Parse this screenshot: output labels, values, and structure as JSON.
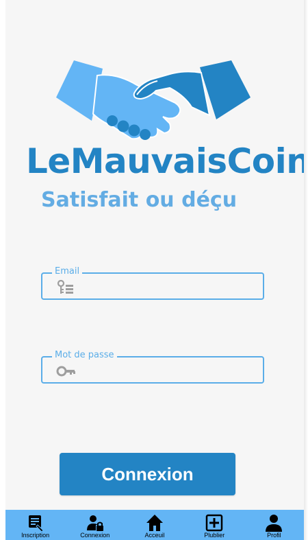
{
  "brand": {
    "title": "LeMauvaisCoin",
    "tagline": "Satisfait ou déçu"
  },
  "form": {
    "email_label": "Email",
    "email_value": "",
    "password_label": "Mot de passe",
    "password_value": "",
    "submit_label": "Connexion"
  },
  "bottom_nav": {
    "items": [
      {
        "label": "Inscription",
        "icon": "inscription-icon"
      },
      {
        "label": "Connexion",
        "icon": "user-lock-icon"
      },
      {
        "label": "Acceuil",
        "icon": "home-icon"
      },
      {
        "label": "Plublier",
        "icon": "add-box-icon"
      },
      {
        "label": "Profil",
        "icon": "person-icon"
      }
    ]
  },
  "colors": {
    "primary": "#2384c4",
    "accent": "#63ace3",
    "nav_bg": "#63b5f5",
    "field_border": "#5aade8",
    "background": "#f6f6f6"
  }
}
